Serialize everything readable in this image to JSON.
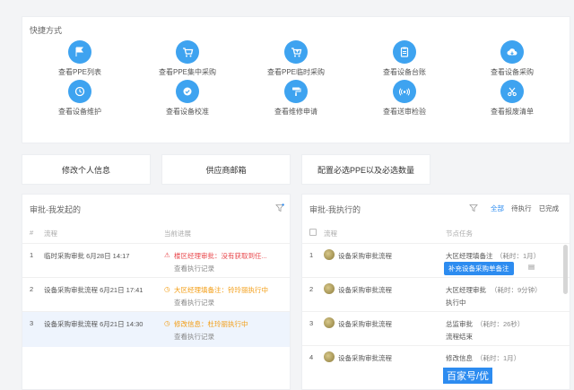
{
  "quick_access": {
    "title": "快捷方式",
    "items": [
      {
        "label": "查看PPE列表",
        "icon": "flag-icon"
      },
      {
        "label": "查看PPE集中采购",
        "icon": "cart-icon"
      },
      {
        "label": "查看PPE临时采购",
        "icon": "cart-plus-icon"
      },
      {
        "label": "查看设备台账",
        "icon": "clipboard-icon"
      },
      {
        "label": "查看设备采购",
        "icon": "cloud-download-icon"
      },
      {
        "label": "查看设备维护",
        "icon": "clock-icon"
      },
      {
        "label": "查看设备校准",
        "icon": "check-gauge-icon"
      },
      {
        "label": "查看维修申请",
        "icon": "paint-roller-icon"
      },
      {
        "label": "查看送审检验",
        "icon": "signal-icon"
      },
      {
        "label": "查看报废清单",
        "icon": "scissors-icon"
      }
    ]
  },
  "links": {
    "edit_profile": "修改个人信息",
    "supplier_mailbox": "供应商邮箱",
    "config_ppe": "配置必选PPE以及必选数量"
  },
  "started": {
    "title": "审批-我发起的",
    "headers": {
      "index": "#",
      "process": "流程",
      "progress": "当前进展"
    },
    "rows": [
      {
        "index": "1",
        "process": "临时采购审批 6月28日 14:17",
        "status": "楼区经理审批：没有获取到任...",
        "link": "查看执行记录",
        "status_type": "warn"
      },
      {
        "index": "2",
        "process": "设备采购审批流程 6月21日 17:41",
        "status": "大区经理填备注：铃玲丽执行中",
        "link": "查看执行记录",
        "status_type": "orange"
      },
      {
        "index": "3",
        "process": "设备采购审批流程 6月21日 14:30",
        "status": "修改信息：杜玲丽执行中",
        "link": "查看执行记录",
        "status_type": "orange"
      }
    ]
  },
  "executed": {
    "title": "审批-我执行的",
    "tabs": {
      "all": "全部",
      "pending": "待执行",
      "done": "已完成"
    },
    "headers": {
      "process": "流程",
      "node": "节点任务"
    },
    "rows": [
      {
        "index": "1",
        "process": "设备采购审批流程",
        "node": "大区经理填备注",
        "time": "（耗时：1月）",
        "action": "补充设备采购单备注"
      },
      {
        "index": "2",
        "process": "设备采购审批流程",
        "node": "大区经理审批",
        "time": "（耗时：9分钟）",
        "status": "执行中"
      },
      {
        "index": "3",
        "process": "设备采购审批流程",
        "node": "总监审批",
        "time": "（耗时：26秒）",
        "status": "流程结束"
      },
      {
        "index": "4",
        "process": "设备采购审批流程",
        "node": "修改信息",
        "time": "（耗时：1月）"
      }
    ]
  },
  "watermark": "百家号/优",
  "colors": {
    "accent": "#2d8cf0",
    "icon_bg": "#3ea3f0",
    "warn": "#e8474b",
    "orange": "#f39c12"
  }
}
